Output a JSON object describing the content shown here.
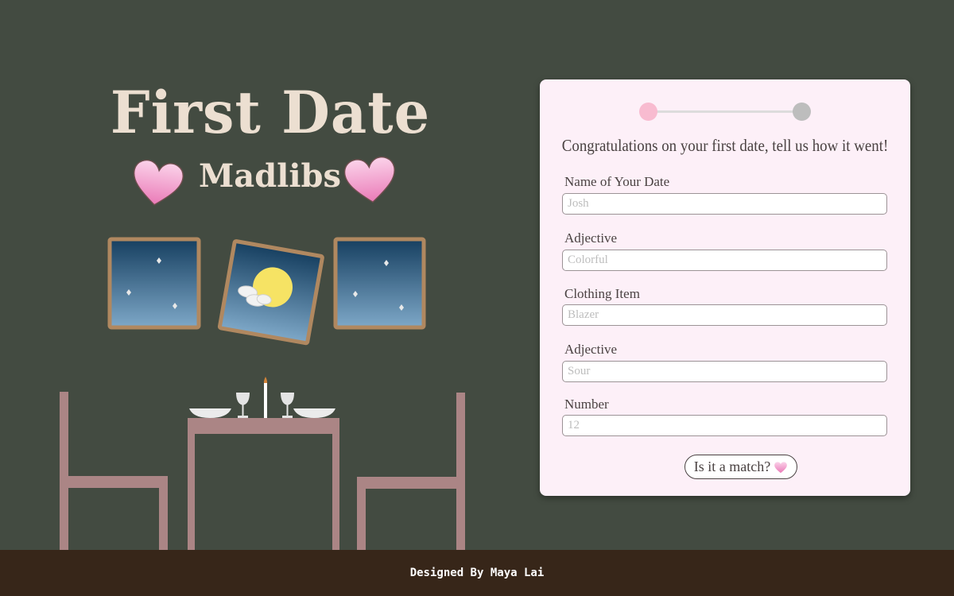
{
  "hero": {
    "title": "First Date",
    "subtitle": "Madlibs"
  },
  "form": {
    "headline": "Congratulations on your first date,  tell us how it went!",
    "progress": {
      "current_step": 1,
      "total_steps": 2
    },
    "fields": [
      {
        "label": "Name of Your Date",
        "placeholder": "Josh"
      },
      {
        "label": "Adjective",
        "placeholder": "Colorful"
      },
      {
        "label": "Clothing Item",
        "placeholder": "Blazer"
      },
      {
        "label": "Adjective",
        "placeholder": "Sour"
      },
      {
        "label": "Number",
        "placeholder": "12"
      }
    ],
    "submit_label": "Is it a match?",
    "submit_icon": "heart-icon"
  },
  "footer": {
    "credit": "Designed By Maya Lai"
  },
  "colors": {
    "background": "#434b41",
    "card": "#fdf0f8",
    "accent_pink": "#f8bbd0",
    "title_cream": "#ecdfd1",
    "furniture": "#ab8585",
    "frame": "#b08860",
    "footer": "#372619"
  }
}
